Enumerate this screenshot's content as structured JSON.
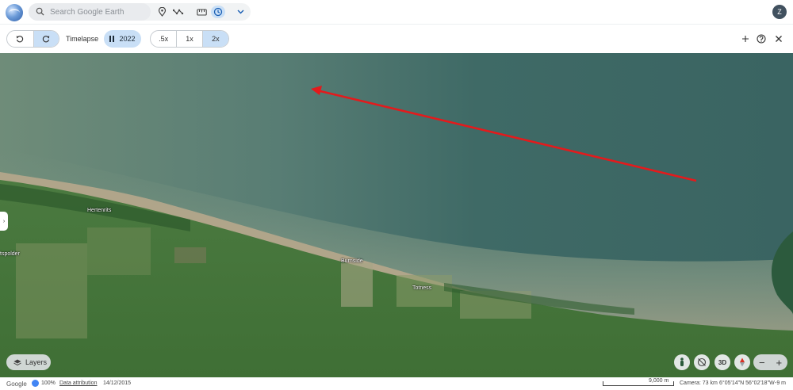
{
  "search": {
    "placeholder": "Search Google Earth"
  },
  "toolbar": {
    "icons": [
      "map-pin-icon",
      "path-icon",
      "ruler-icon",
      "timelapse-icon",
      "chevron-down-icon"
    ]
  },
  "user": {
    "initial": "Z"
  },
  "timelapse": {
    "label": "Timelapse",
    "year": "2022",
    "speeds": [
      ".5x",
      "1x",
      "2x"
    ],
    "selected_speed": "2x"
  },
  "places": {
    "hertenrits": "Hertenrits",
    "spolder": "tspolder",
    "burnside": "Burnside",
    "totness": "Totness"
  },
  "map_controls": {
    "layers": "Layers",
    "three_d": "3D",
    "zoom_out": "−",
    "zoom_in": "+"
  },
  "status": {
    "brand": "Google",
    "percent": "100%",
    "data_link": "Data attribution",
    "date": "14/12/2015",
    "scale": "9,000 m",
    "camera": "Camera: 73 km",
    "coords": "6°05'14\"N 56°02'18\"W",
    "elevation": "-9 m"
  },
  "colors": {
    "sea": "#3f6a66",
    "shore_sand": "#b5a88d",
    "land": "#4f7a3c",
    "arrow": "#e41a1c",
    "active_pill": "#c9dff6"
  }
}
